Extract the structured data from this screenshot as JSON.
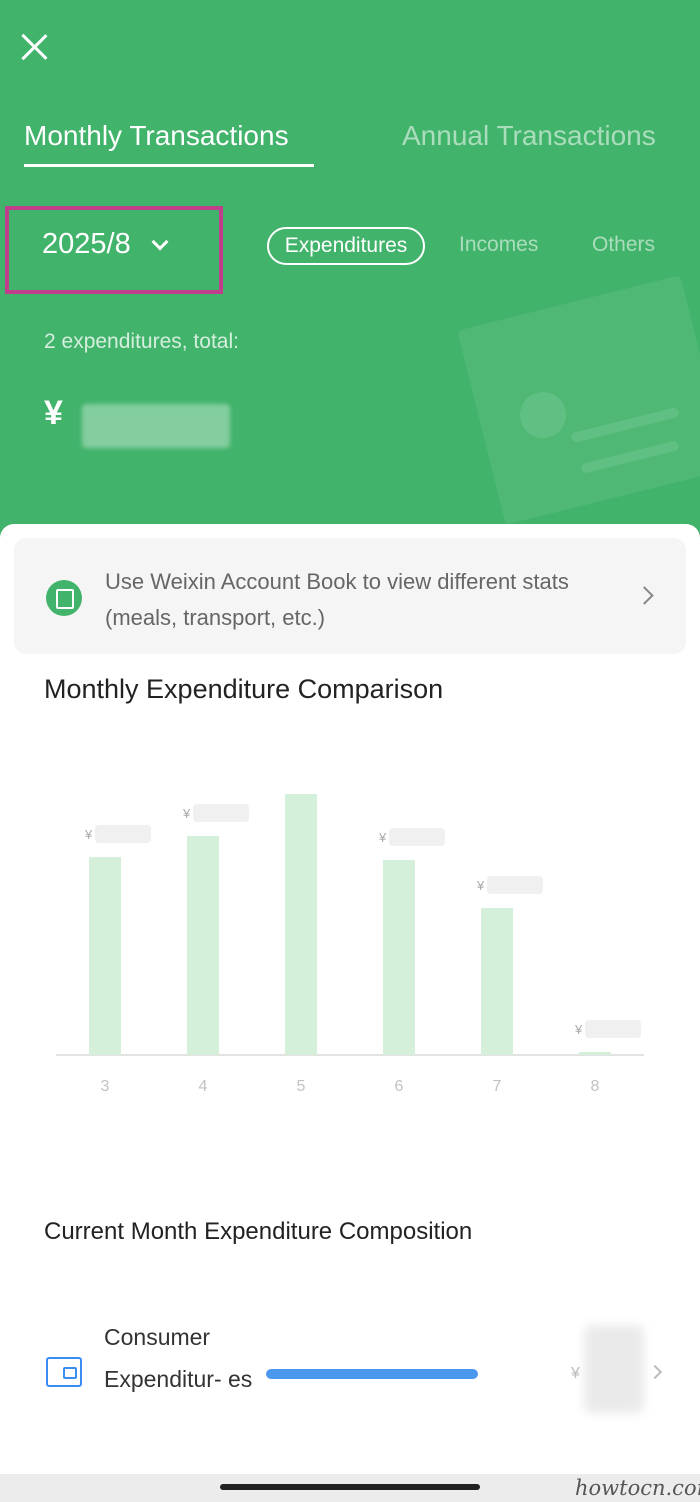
{
  "header": {
    "close_icon": "close-icon",
    "tabs": [
      {
        "label": "Monthly Transactions",
        "active": true
      },
      {
        "label": "Annual Transactions",
        "active": false
      }
    ],
    "date_selector": {
      "value": "2025/8",
      "icon": "chevron-down-icon"
    },
    "segments": [
      {
        "label": "Expenditures",
        "active": true
      },
      {
        "label": "Incomes",
        "active": false
      },
      {
        "label": "Others",
        "active": false
      }
    ],
    "summary": {
      "count_text": "2 expenditures, total:",
      "currency": "¥"
    }
  },
  "tip_banner": {
    "text": "Use Weixin Account Book to view different stats (meals, transport, etc.)",
    "icon": "account-book-icon"
  },
  "comparison": {
    "title": "Monthly Expenditure Comparison"
  },
  "chart_data": {
    "type": "bar",
    "categories": [
      "3",
      "4",
      "5",
      "6",
      "7",
      "8"
    ],
    "values": [
      0.66,
      0.73,
      0.87,
      0.65,
      0.49,
      0.01
    ],
    "data_label_prefix": "¥",
    "bar_color": "#d4f0db",
    "xlabel": "",
    "ylabel": "",
    "grid": false
  },
  "composition": {
    "title": "Current Month Expenditure Composition",
    "items": [
      {
        "label": "Consumer Expenditur- es",
        "share": 1.0,
        "currency": "¥",
        "icon": "wallet-icon"
      }
    ]
  },
  "watermark": "howtocn.com",
  "colors": {
    "brand_green": "#42b36b",
    "highlight_box": "#c03e8c",
    "bar_blue": "#4c98ec"
  }
}
